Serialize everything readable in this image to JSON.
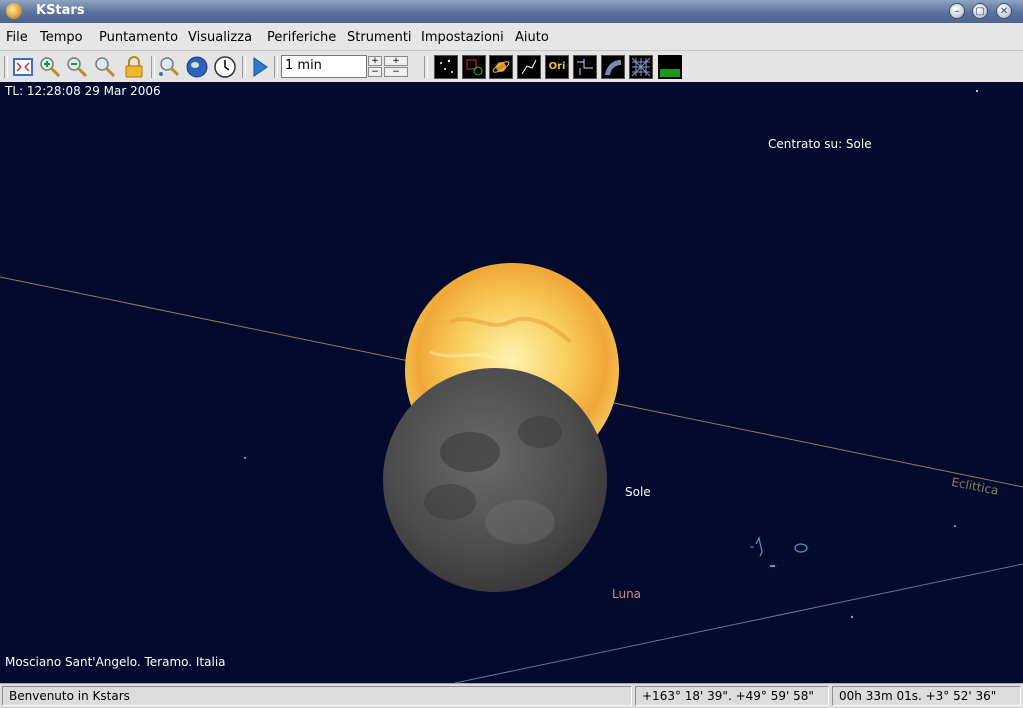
{
  "window": {
    "title": "KStars"
  },
  "menu": [
    "File",
    "Tempo",
    "Puntamento",
    "Visualizza",
    "Periferiche",
    "Strumenti",
    "Impostazioni",
    "Aiuto"
  ],
  "toolbar": {
    "time_step": "1 min",
    "icons": [
      "default-zoom-icon",
      "zoom-in-icon",
      "zoom-out-icon",
      "zoom-to-angular-size-icon",
      "lock-icon",
      "find-object-icon",
      "geographic-location-icon",
      "set-time-icon",
      "start-clock-icon"
    ],
    "view_toggles": [
      "toggle-stars-icon",
      "toggle-deep-sky-icon",
      "toggle-solar-system-icon",
      "toggle-constellation-lines-icon",
      "toggle-constellation-names-icon",
      "toggle-constellation-boundaries-icon",
      "toggle-milky-way-icon",
      "toggle-coordinate-grid-icon",
      "toggle-ground-icon"
    ],
    "constellation_names_label": "Ori"
  },
  "sky": {
    "time_label": "TL: 12:28:08   29 Mar 2006",
    "centered_label": "Centrato su: Sole",
    "sun_label": "Sole",
    "moon_label": "Luna",
    "ecliptic_label": "Eclittica",
    "location_label": "Mosciano Sant'Angelo. Teramo.  Italia",
    "colors": {
      "sky": "#030a2e",
      "ecliptic": "#8c8050",
      "moon_label": "#c8907a",
      "ecliptic_label": "#8c8050",
      "horizon_line": "#6e7096"
    }
  },
  "status": {
    "message": "Benvenuto in Kstars",
    "alt_az": "+163° 18' 39\".  +49° 59' 58\"",
    "ra_dec": "00h 33m 01s.  +3° 52' 36\""
  }
}
